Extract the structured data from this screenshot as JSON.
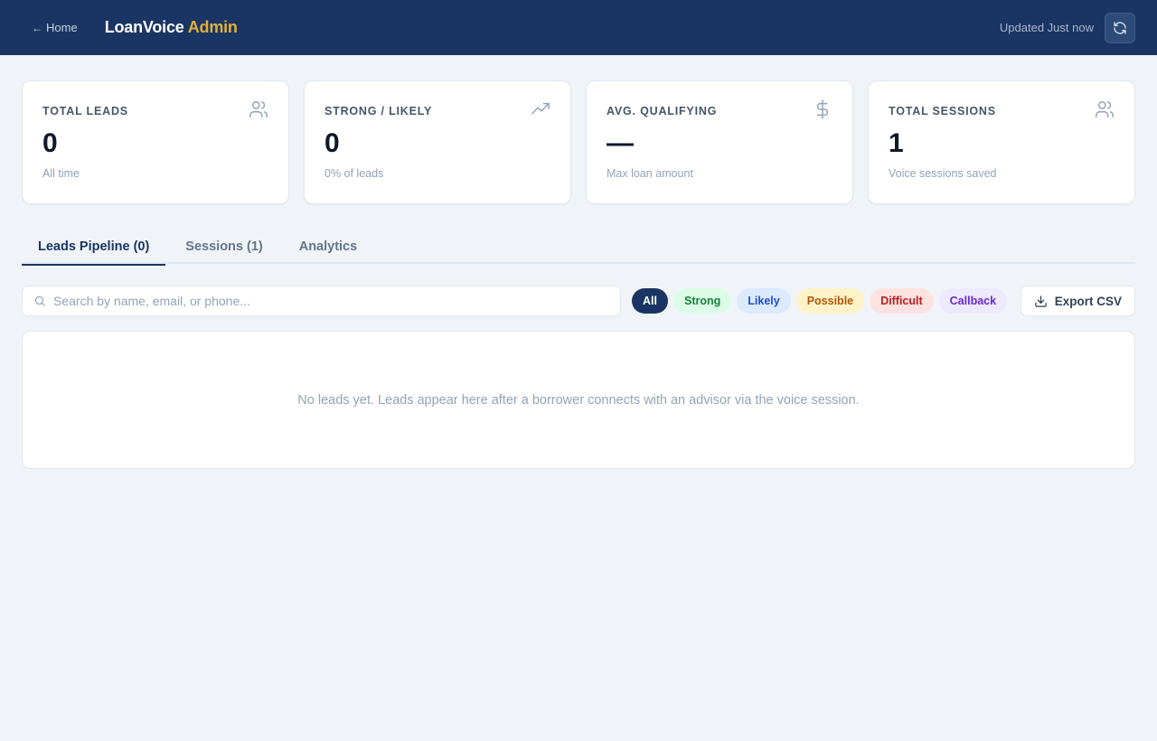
{
  "header": {
    "home_label": "Home",
    "home_arrow": "←",
    "brand_main": "LoanVoice",
    "brand_accent": "Admin",
    "updated_text": "Updated Just now",
    "refresh_icon": "refresh-icon"
  },
  "stats": [
    {
      "label": "TOTAL LEADS",
      "value": "0",
      "sub": "All time",
      "icon": "users-icon"
    },
    {
      "label": "STRONG / LIKELY",
      "value": "0",
      "sub": "0% of leads",
      "icon": "trending-up-icon"
    },
    {
      "label": "AVG. QUALIFYING",
      "value": "—",
      "sub": "Max loan amount",
      "icon": "dollar-icon"
    },
    {
      "label": "TOTAL SESSIONS",
      "value": "1",
      "sub": "Voice sessions saved",
      "icon": "users-icon"
    }
  ],
  "tabs": [
    {
      "label": "Leads Pipeline (0)",
      "active": true
    },
    {
      "label": "Sessions (1)",
      "active": false
    },
    {
      "label": "Analytics",
      "active": false
    }
  ],
  "search": {
    "placeholder": "Search by name, email, or phone...",
    "value": ""
  },
  "filters": [
    {
      "label": "All",
      "selected": true
    },
    {
      "label": "Strong",
      "selected": false
    },
    {
      "label": "Likely",
      "selected": false
    },
    {
      "label": "Possible",
      "selected": false
    },
    {
      "label": "Difficult",
      "selected": false
    },
    {
      "label": "Callback",
      "selected": false
    }
  ],
  "export_label": "Export CSV",
  "empty_message": "No leads yet. Leads appear here after a borrower connects with an advisor via the voice session.",
  "colors": {
    "header_bg": "#1a3563",
    "brand_accent": "#e1b13a",
    "page_bg": "#f0f4f9"
  }
}
